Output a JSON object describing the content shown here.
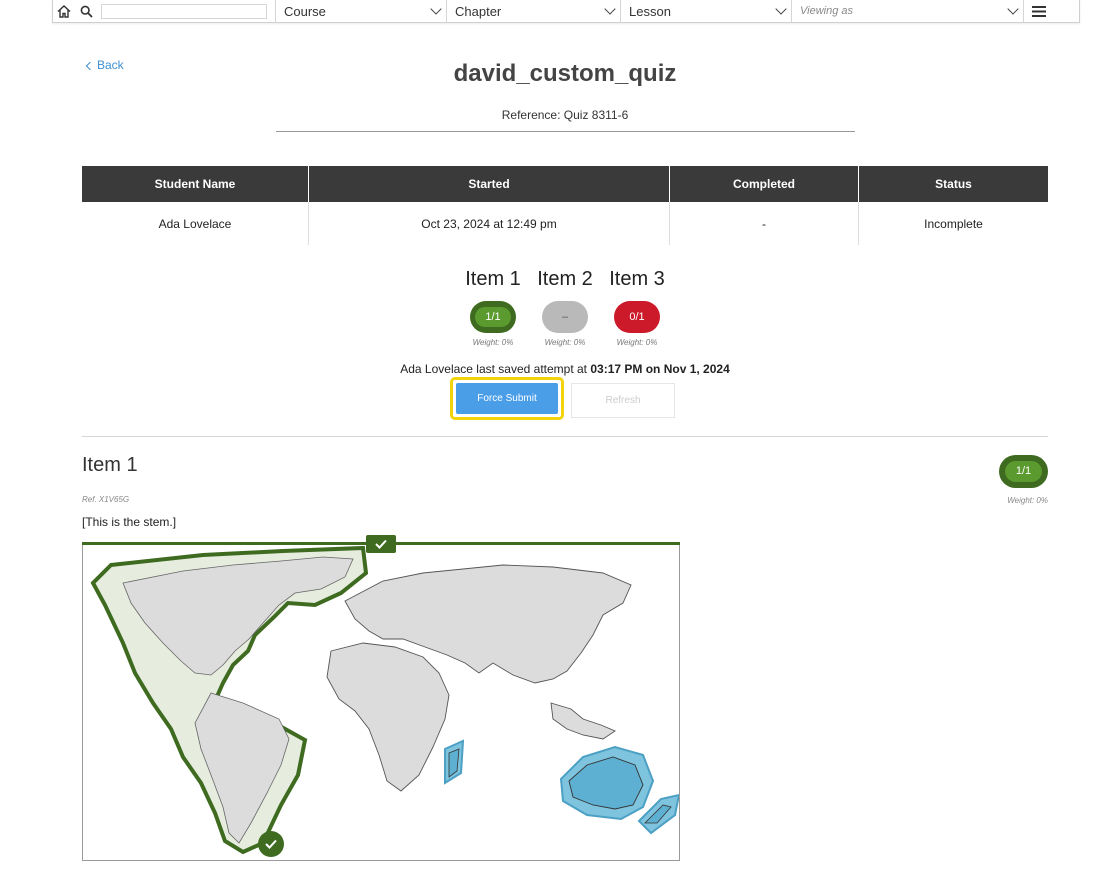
{
  "toolbar": {
    "home_icon": "home-icon",
    "search_icon": "search-icon",
    "search_value": "",
    "course": "Course",
    "chapter": "Chapter",
    "lesson": "Lesson",
    "viewing_as": "Viewing as",
    "menu_icon": "hamburger-icon"
  },
  "header": {
    "back": "Back",
    "title": "david_custom_quiz",
    "reference": "Reference: Quiz 8311-6"
  },
  "table": {
    "headers": [
      "Student Name",
      "Started",
      "Completed",
      "Status"
    ],
    "rows": [
      [
        "Ada Lovelace",
        "Oct 23, 2024 at 12:49 pm",
        "-",
        "Incomplete"
      ]
    ]
  },
  "items": [
    {
      "label": "Item 1",
      "score": "1/1",
      "weight": "Weight: 0%",
      "status_color": "#3e6b1f"
    },
    {
      "label": "Item 2",
      "score": "–",
      "weight": "Weight: 0%",
      "status_color": "#b9b9b9"
    },
    {
      "label": "Item 3",
      "score": "0/1",
      "weight": "Weight: 0%",
      "status_color": "#cc1a2a"
    }
  ],
  "saved": {
    "prefix": "Ada Lovelace last saved attempt at ",
    "when": "03:17 PM on Nov 1, 2024"
  },
  "buttons": {
    "force_submit": "Force Submit",
    "refresh": "Refresh"
  },
  "item_detail": {
    "title": "Item 1",
    "ref": "Ref. X1V65G",
    "stem": "[This is the stem.]",
    "score": "1/1",
    "weight": "Weight: 0%"
  },
  "colors": {
    "correct": "#3e6b1f",
    "incorrect_region": "#6fb8d6",
    "accent": "#4a9ee8",
    "highlight": "#f2d30c"
  }
}
